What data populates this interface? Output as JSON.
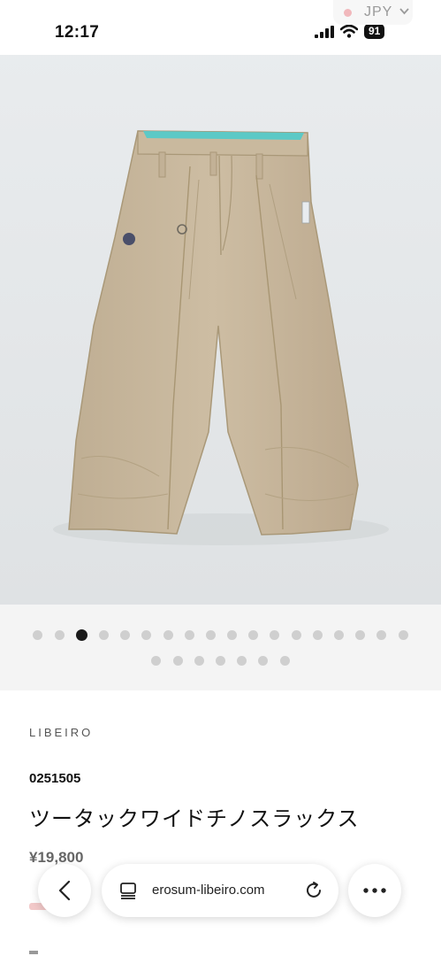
{
  "status_bar": {
    "time": "12:17",
    "battery": "91",
    "icons": [
      "cellular-signal-icon",
      "wifi-icon",
      "battery-icon"
    ]
  },
  "currency_selector": {
    "label": "JPY",
    "icon": "chevron-down-icon"
  },
  "gallery": {
    "total_images": 25,
    "active_index": 2
  },
  "product": {
    "brand": "LIBEIRO",
    "code": "0251505",
    "title": "ツータックワイドチノスラックス",
    "price": "¥19,800"
  },
  "browser": {
    "url": "erosum-libeiro.com",
    "icons": [
      "back-icon",
      "reader-icon",
      "reload-icon",
      "more-icon"
    ]
  },
  "colors": {
    "product_khaki": "#c6b59b",
    "waistband_lining": "#5cc9c6",
    "active_dot": "#1b1b1b",
    "inactive_dot": "#cfcfcf"
  }
}
